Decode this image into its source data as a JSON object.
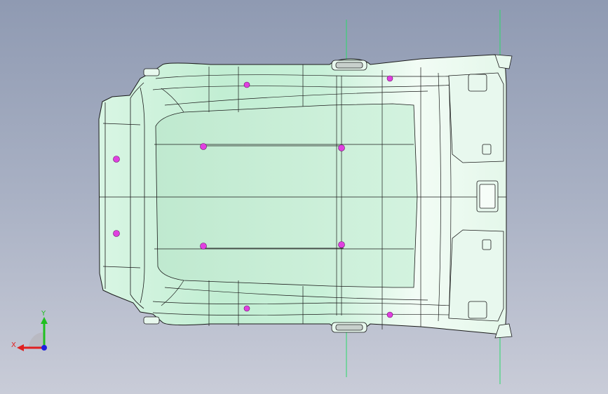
{
  "viewport": {
    "background_top": "#8f9ab2",
    "background_bottom": "#c9ccd8"
  },
  "model": {
    "part_name": "headliner",
    "surface_color": "#c7f0d8",
    "surface_highlight": "#eefbf2",
    "edge_color": "#1a1a1a",
    "hole_color": "#e040e0",
    "reference_line_color": "#2bd96b"
  },
  "triad": {
    "x_label": "X",
    "y_label": "Y",
    "x_color": "#e02020",
    "y_color": "#20c020",
    "z_color": "#2020e0"
  }
}
